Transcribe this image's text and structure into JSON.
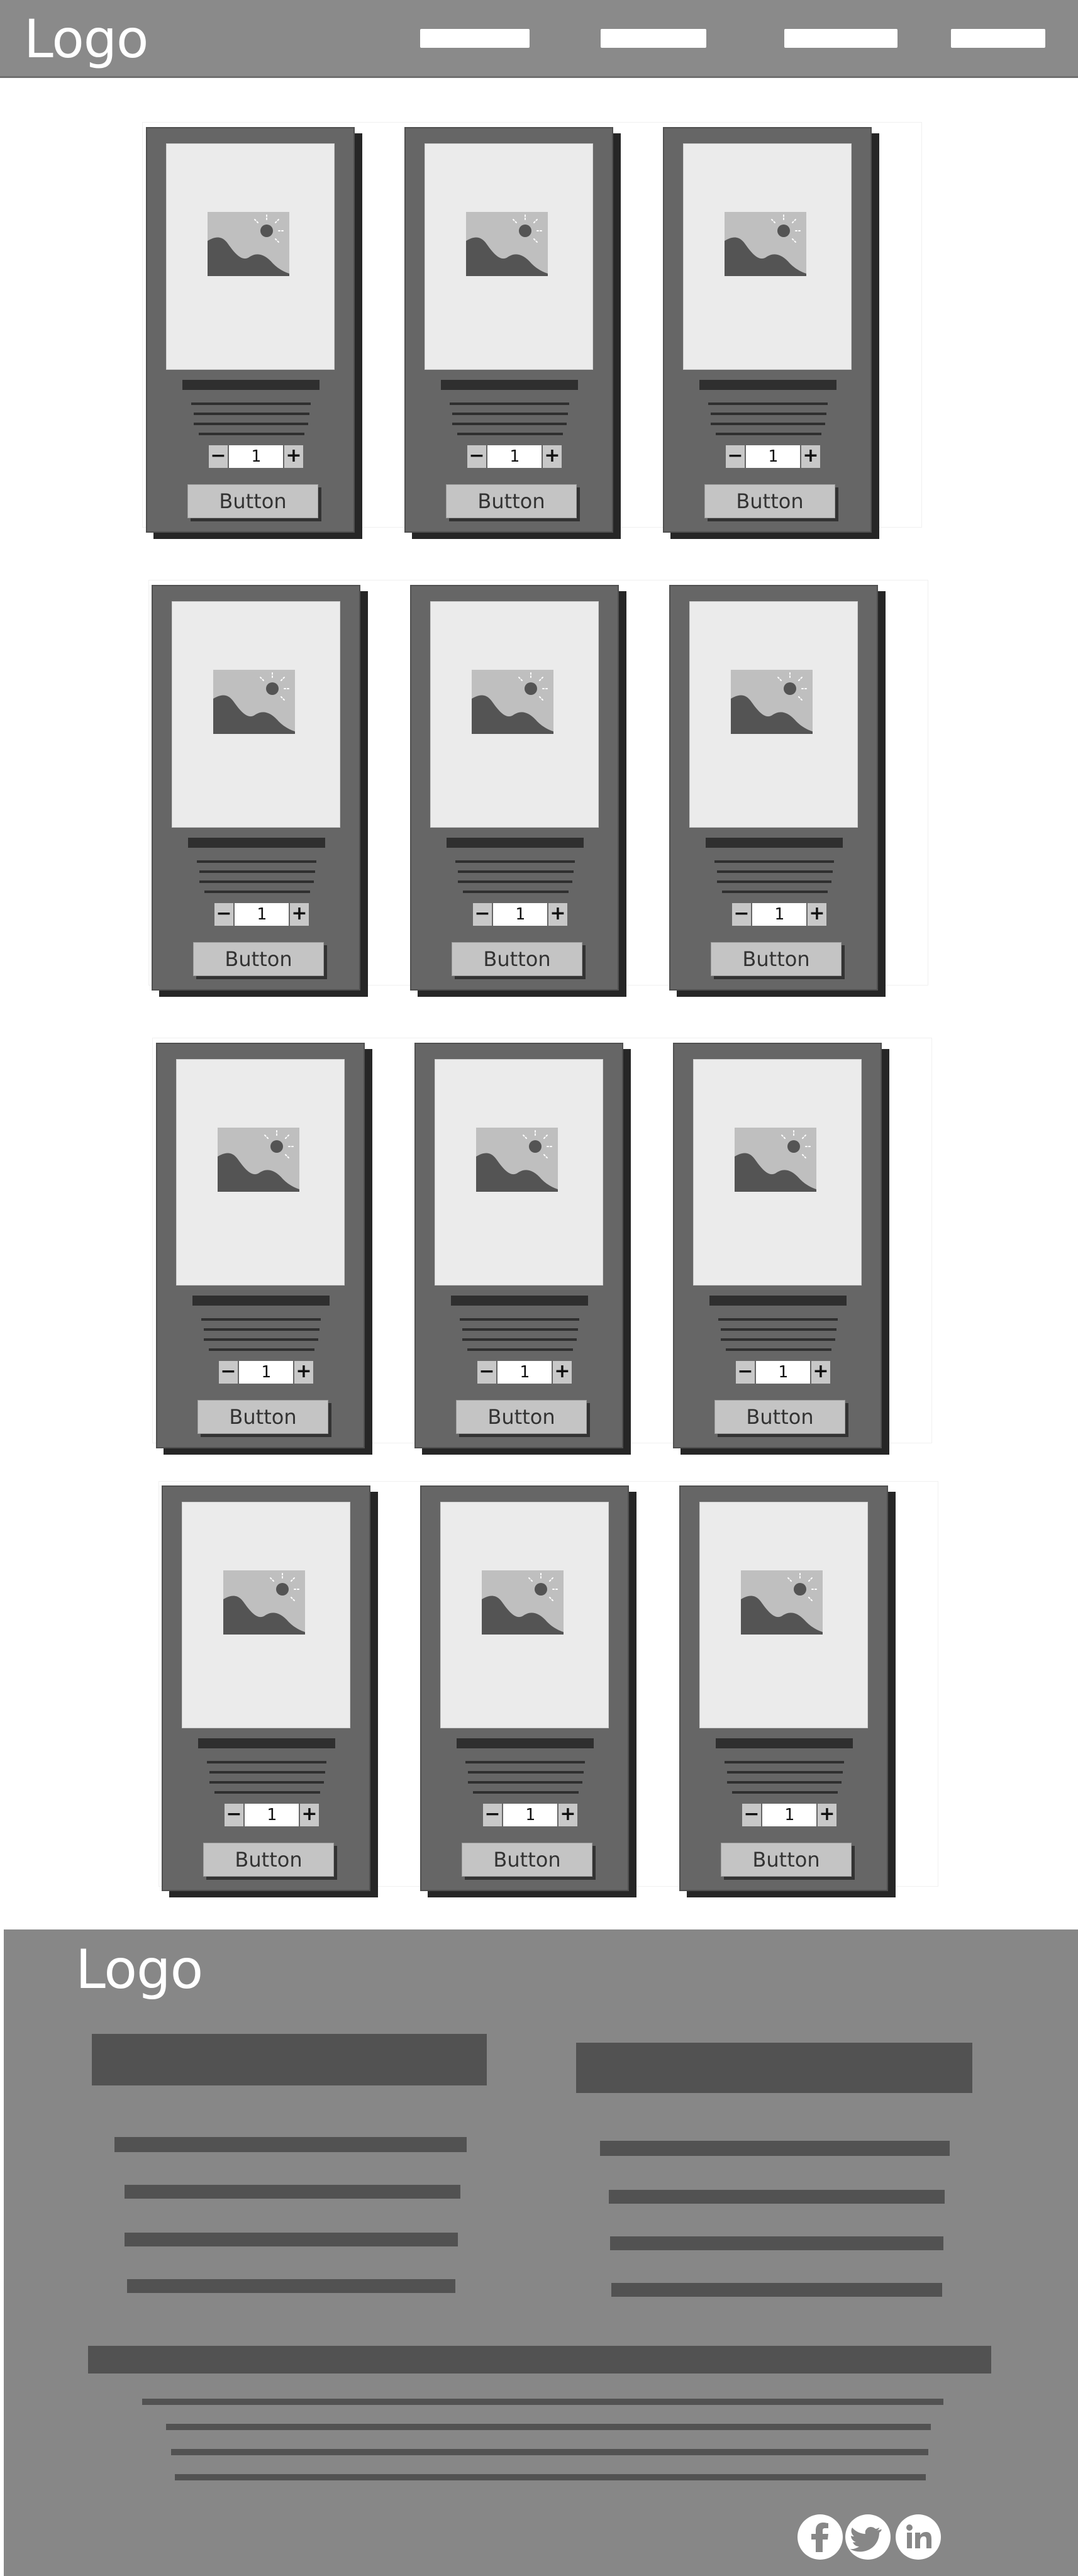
{
  "header": {
    "logo": "Logo",
    "nav_links": [
      "",
      "",
      "",
      ""
    ]
  },
  "products": {
    "rows": [
      [
        {
          "quantity": "1",
          "button_label": "Button"
        },
        {
          "quantity": "1",
          "button_label": "Button"
        },
        {
          "quantity": "1",
          "button_label": "Button"
        }
      ],
      [
        {
          "quantity": "1",
          "button_label": "Button"
        },
        {
          "quantity": "1",
          "button_label": "Button"
        },
        {
          "quantity": "1",
          "button_label": "Button"
        }
      ],
      [
        {
          "quantity": "1",
          "button_label": "Button"
        },
        {
          "quantity": "1",
          "button_label": "Button"
        },
        {
          "quantity": "1",
          "button_label": "Button"
        }
      ],
      [
        {
          "quantity": "1",
          "button_label": "Button"
        },
        {
          "quantity": "1",
          "button_label": "Button"
        },
        {
          "quantity": "1",
          "button_label": "Button"
        }
      ]
    ],
    "quantity_decrement": "−",
    "quantity_increment": "+",
    "image_icon": "image-placeholder-icon"
  },
  "footer": {
    "logo": "Logo",
    "social": [
      {
        "name": "facebook-icon"
      },
      {
        "name": "twitter-icon"
      },
      {
        "name": "linkedin-icon"
      }
    ]
  },
  "colors": {
    "header_bg": "#8a8a8a",
    "card_bg": "#666666",
    "card_shadow": "#262626",
    "footer_bg": "#878787",
    "footer_bar": "#525252"
  }
}
